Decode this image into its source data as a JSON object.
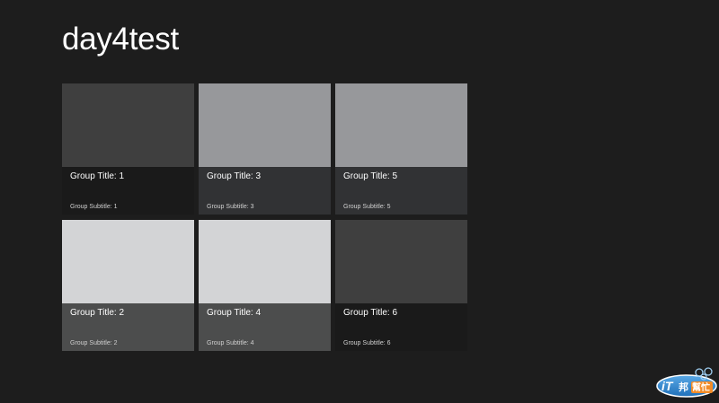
{
  "app": {
    "title": "day4test"
  },
  "groups": [
    {
      "title": "Group Title: 1",
      "subtitle": "Group Subtitle: 1",
      "image_color": "#3f3f3f",
      "overlay_color": "#1a1a1a"
    },
    {
      "title": "Group Title: 2",
      "subtitle": "Group Subtitle: 2",
      "image_color": "#d3d4d6",
      "overlay_color": "#4c4d4d"
    },
    {
      "title": "Group Title: 3",
      "subtitle": "Group Subtitle: 3",
      "image_color": "#97989b",
      "overlay_color": "#313234"
    },
    {
      "title": "Group Title: 4",
      "subtitle": "Group Subtitle: 4",
      "image_color": "#d3d4d6",
      "overlay_color": "#4c4d4d"
    },
    {
      "title": "Group Title: 5",
      "subtitle": "Group Subtitle: 5",
      "image_color": "#97989b",
      "overlay_color": "#313234"
    },
    {
      "title": "Group Title: 6",
      "subtitle": "Group Subtitle: 6",
      "image_color": "#3f3f3f",
      "overlay_color": "#1a1a1a"
    }
  ],
  "watermark": {
    "text": "iT邦幫忙",
    "icon": "ithome-logo-icon"
  }
}
